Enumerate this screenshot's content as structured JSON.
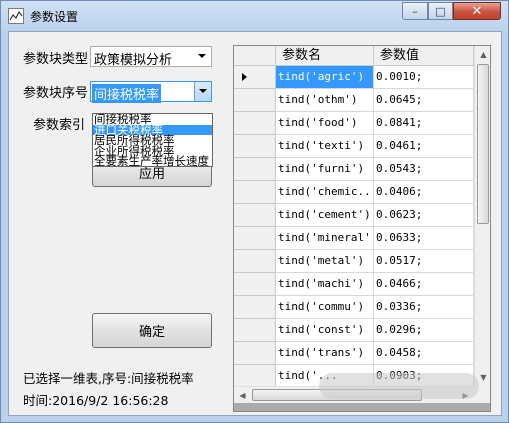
{
  "window": {
    "title": "参数设置",
    "controls": {
      "minimize": "–",
      "maximize": "□",
      "close": "✕"
    },
    "icon": "chart-line-icon"
  },
  "form": {
    "block_type_label": "参数块类型",
    "block_type_value": "政策模拟分析",
    "block_index_label": "参数块序号",
    "block_index_value": "间接税税率",
    "param_index_label": "参数索引",
    "dropdown_options": [
      "间接税税率",
      "进口关税税率",
      "居民所得税税率",
      "企业所得税税率",
      "全要素生产率增长速度"
    ],
    "dropdown_selected_index": 1,
    "apply_button": "应用",
    "confirm_button": "确定"
  },
  "status": {
    "selection_text": "已选择一维表,序号:间接税税率",
    "time_text": "时间:2016/9/2 16:56:28"
  },
  "grid": {
    "columns": [
      "参数名",
      "参数值"
    ],
    "rows": [
      {
        "name": "tind('agric')",
        "value": "0.0010;"
      },
      {
        "name": "tind('othm')",
        "value": "0.0645;"
      },
      {
        "name": "tind('food')",
        "value": "0.0841;"
      },
      {
        "name": "tind('texti')",
        "value": "0.0461;"
      },
      {
        "name": "tind('furni')",
        "value": "0.0543;"
      },
      {
        "name": "tind('chemic...",
        "value": "0.0406;"
      },
      {
        "name": "tind('cement')",
        "value": "0.0623;"
      },
      {
        "name": "tind('mineral')",
        "value": "0.0633;"
      },
      {
        "name": "tind('metal')",
        "value": "0.0517;"
      },
      {
        "name": "tind('machi')",
        "value": "0.0466;"
      },
      {
        "name": "tind('commu')",
        "value": "0.0336;"
      },
      {
        "name": "tind('const')",
        "value": "0.0296;"
      },
      {
        "name": "tind('trans')",
        "value": "0.0458;"
      },
      {
        "name": "tind('...",
        "value": "0.0903;"
      }
    ],
    "selected_row": 0
  },
  "colors": {
    "selection": "#3399ff",
    "frame": "#b9d1ea",
    "close_button": "#c9513c"
  }
}
